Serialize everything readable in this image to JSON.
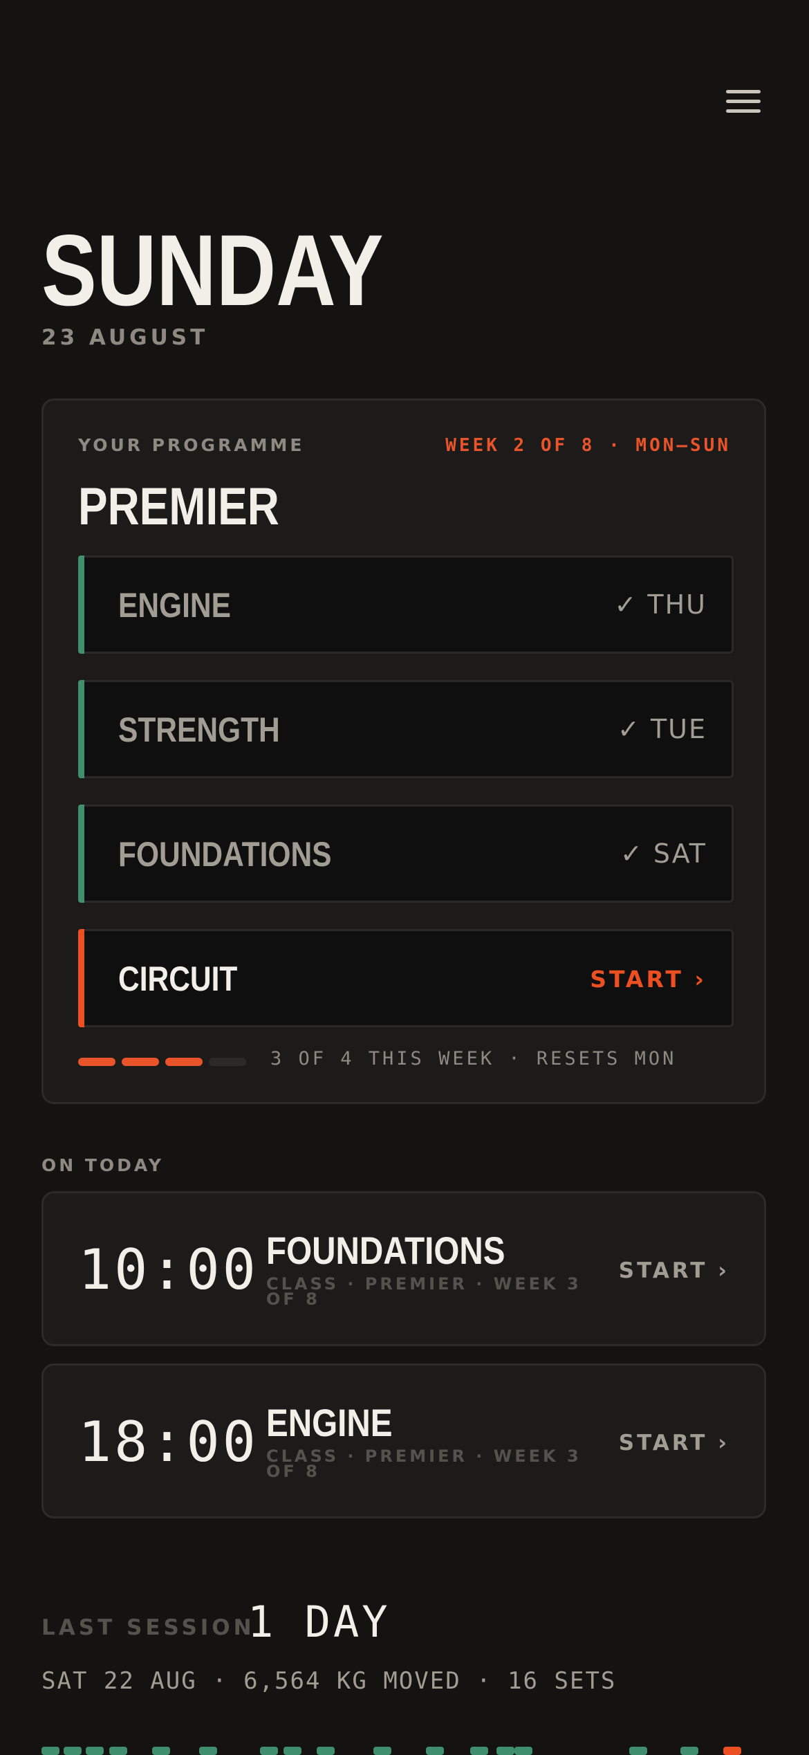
{
  "header": {
    "menu_icon": "hamburger-menu-icon",
    "day": "SUNDAY",
    "date": "23 AUGUST"
  },
  "programme": {
    "label": "YOUR PROGRAMME",
    "week": "WEEK 2 OF 8 · MON–SUN",
    "name": "PREMIER",
    "sessions": [
      {
        "name": "ENGINE",
        "status": "✓ THU"
      },
      {
        "name": "STRENGTH",
        "status": "✓ TUE"
      },
      {
        "name": "FOUNDATIONS",
        "status": "✓ SAT"
      },
      {
        "name": "CIRCUIT",
        "status": "START ›"
      }
    ],
    "progress_done": 3,
    "progress_total": 4,
    "progress_text": "3 OF 4 THIS WEEK · RESETS MON",
    "colors": {
      "done": "#3f8e6e",
      "active": "#ec4f21"
    }
  },
  "on_today": {
    "label": "ON TODAY",
    "classes": [
      {
        "time": "10:00",
        "name": "FOUNDATIONS",
        "meta": "CLASS · PREMIER · WEEK 3 OF 8",
        "action": "START ›"
      },
      {
        "time": "18:00",
        "name": "ENGINE",
        "meta": "CLASS · PREMIER · WEEK 3 OF 8",
        "action": "START ›"
      }
    ]
  },
  "last_session": {
    "label": "LAST SESSION",
    "value": "1 DAY",
    "detail": "SAT 22 AUG · 6,564 KG MOVED · 16 SETS"
  }
}
